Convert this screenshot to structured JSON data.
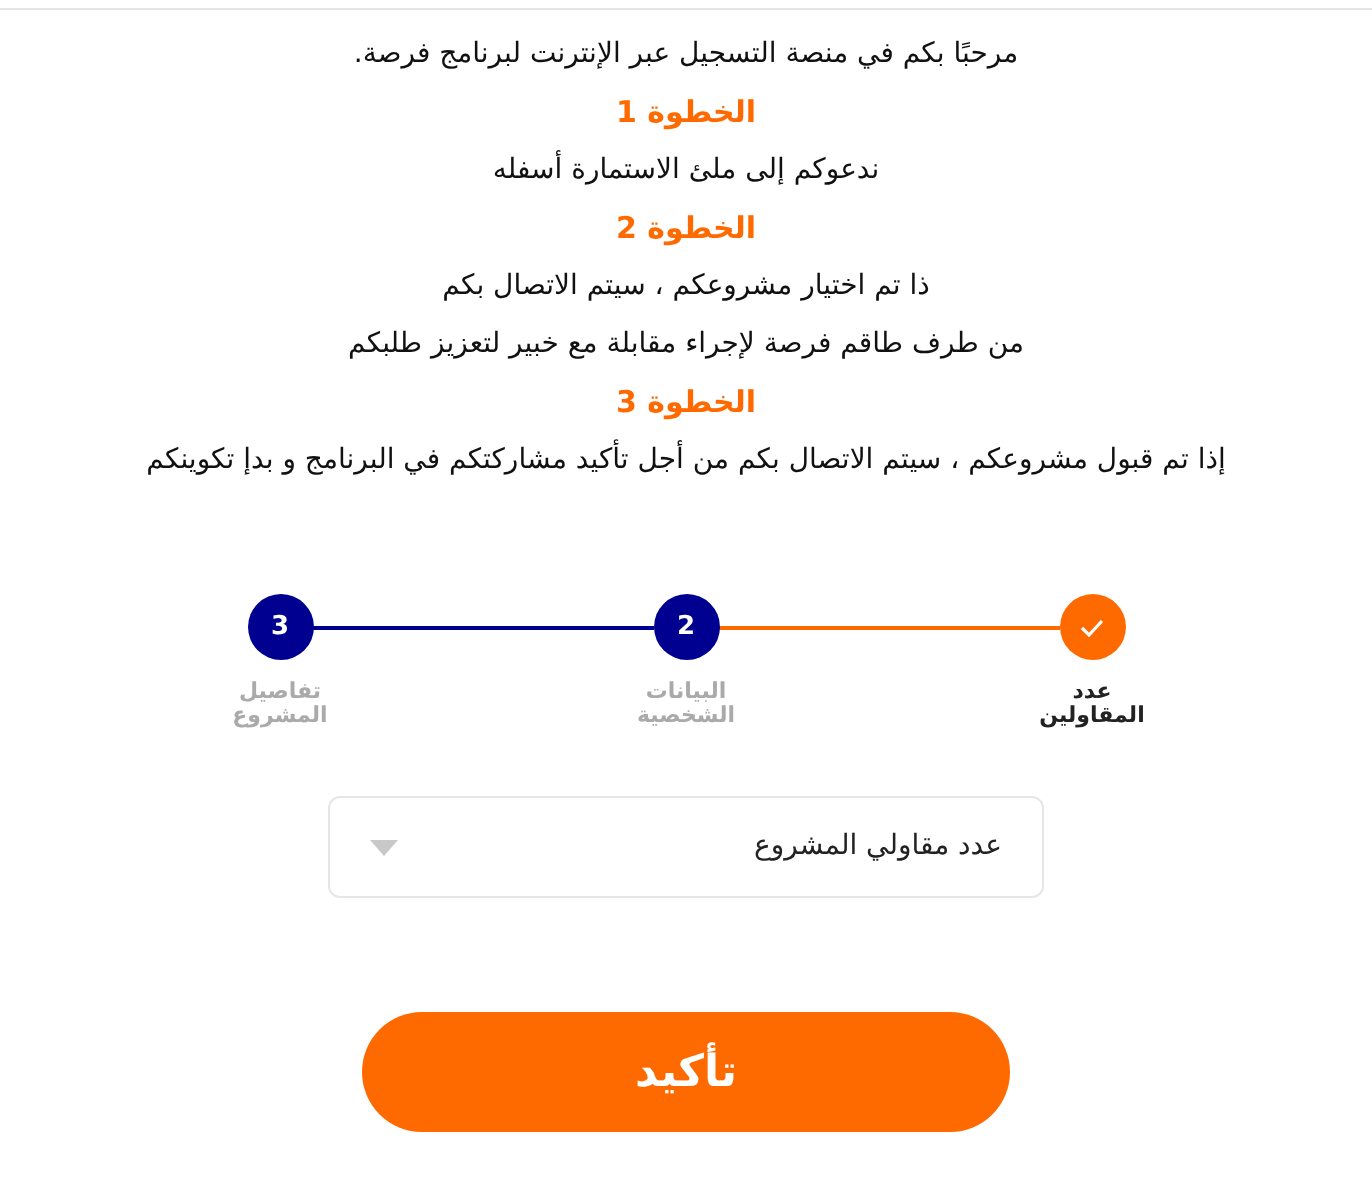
{
  "intro": [
    {
      "kind": "text",
      "text": "مرحبًا بكم في منصة التسجيل عبر الإنترنت لبرنامج فرصة."
    },
    {
      "kind": "heading",
      "text": "الخطوة 1"
    },
    {
      "kind": "text",
      "text": "ندعوكم إلى ملئ الاستمارة أسفله"
    },
    {
      "kind": "heading",
      "text": "الخطوة 2"
    },
    {
      "kind": "text",
      "text": "ذا تم اختيار مشروعكم ، سيتم الاتصال بكم"
    },
    {
      "kind": "text",
      "text": "من طرف طاقم فرصة لإجراء مقابلة مع خبير لتعزيز طلبكم"
    },
    {
      "kind": "heading",
      "text": "الخطوة 3"
    },
    {
      "kind": "text",
      "text": "إذا تم قبول مشروعكم ، سيتم الاتصال بكم من أجل تأكيد مشاركتكم في البرنامج و بدإ تكوينكم"
    }
  ],
  "steps": [
    {
      "label": "عدد المقاولين",
      "done": true,
      "selected": true
    },
    {
      "number": "2",
      "label": "البيانات الشخصية",
      "done": false,
      "selected": false
    },
    {
      "number": "3",
      "label": "تفاصيل المشروع",
      "done": false,
      "selected": false
    }
  ],
  "select": {
    "value": "عدد مقاولي المشروع"
  },
  "submit": {
    "label": "تأكيد"
  }
}
